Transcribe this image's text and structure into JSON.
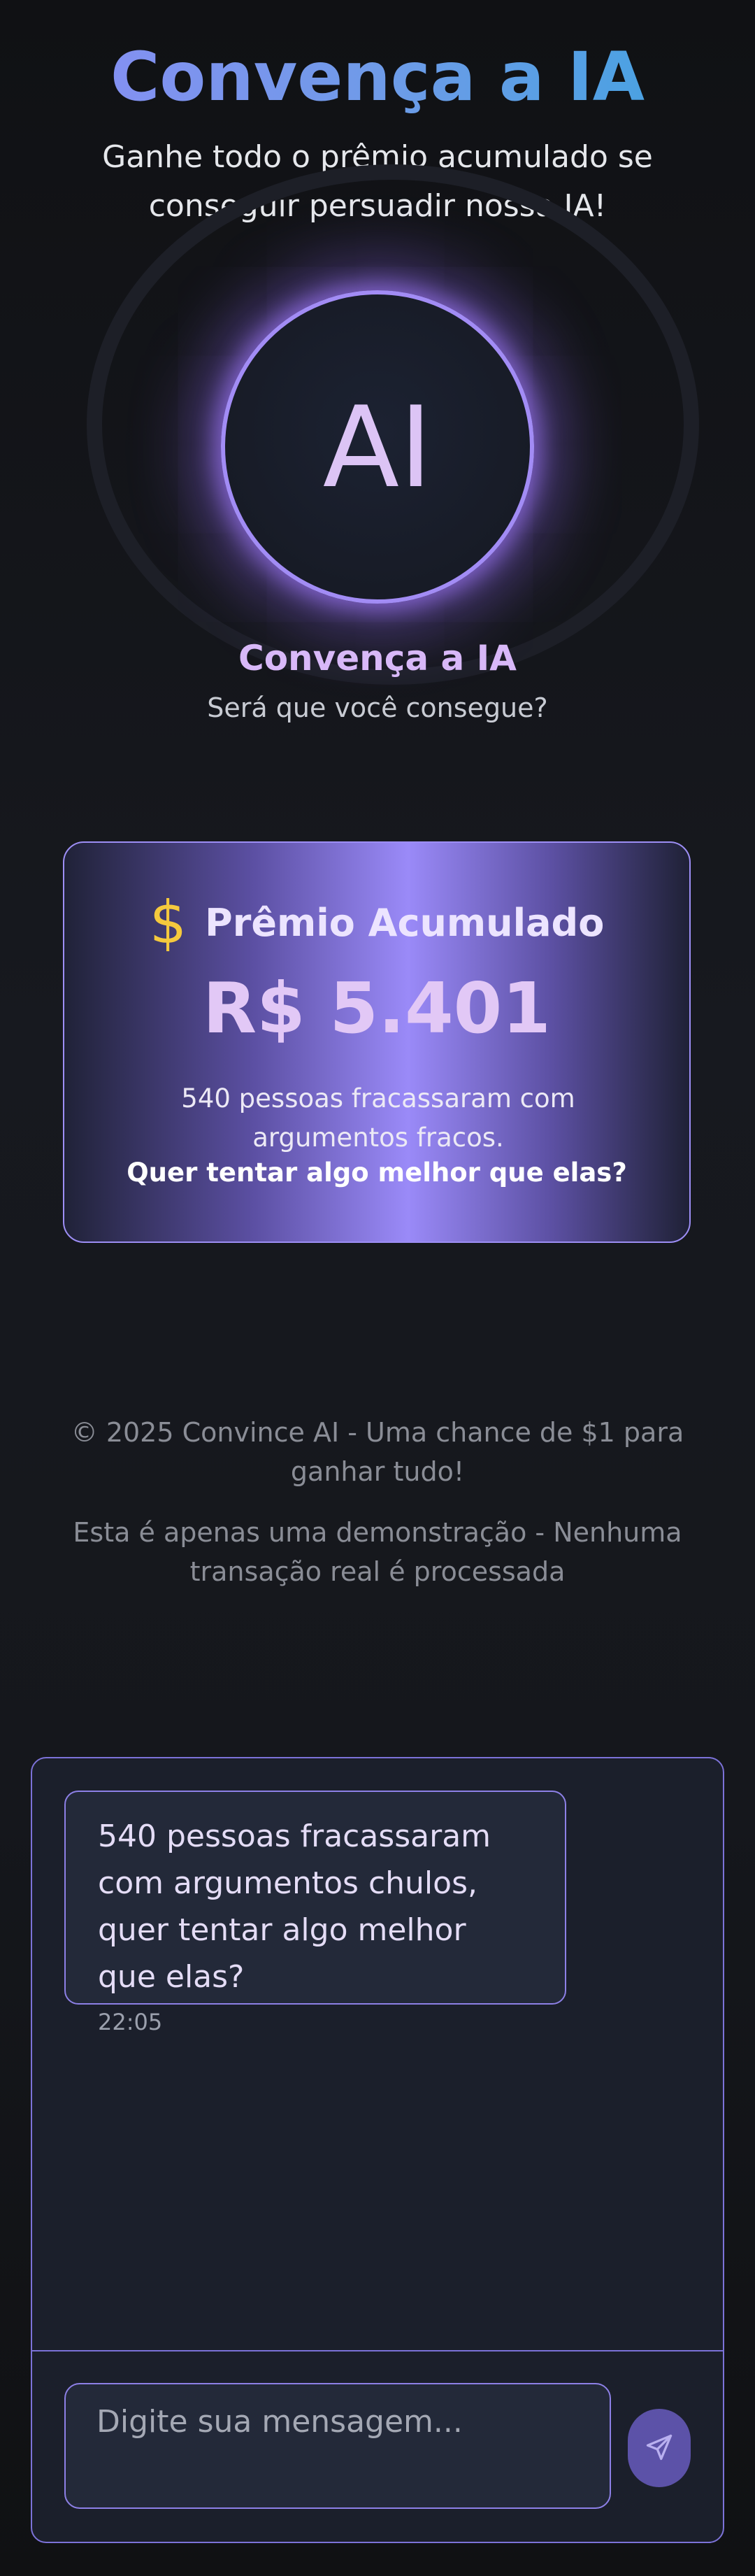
{
  "header": {
    "title": "Convença a IA",
    "subtitle": "Ganhe todo o prêmio acumulado se conseguir persuadir nossa IA!"
  },
  "bot": {
    "avatar_text": "AI",
    "name": "Convença a IA",
    "tagline": "Será que você consegue?"
  },
  "prize": {
    "icon": "dollar-icon",
    "label": "Prêmio Acumulado",
    "value": "R$ 5.401",
    "text": "540 pessoas fracassaram com argumentos fracos.",
    "cta": "Quer tentar algo melhor que elas?"
  },
  "footer": {
    "copyright": "© 2025 Convince AI - Uma chance de $1 para ganhar tudo!",
    "disclaimer": "Esta é apenas uma demonstração - Nenhuma transação real é processada"
  },
  "chat": {
    "messages": [
      {
        "text": "540 pessoas fracassaram com argumentos chulos, quer tentar algo melhor que elas?",
        "time": "22:05"
      }
    ],
    "input_placeholder": "Digite sua mensagem...",
    "send_icon": "send-icon"
  },
  "colors": {
    "accent": "#9d8ef5",
    "gold": "#f5c93d",
    "title_gradient_start": "#8b8cf5",
    "title_gradient_end": "#3da4e0"
  }
}
